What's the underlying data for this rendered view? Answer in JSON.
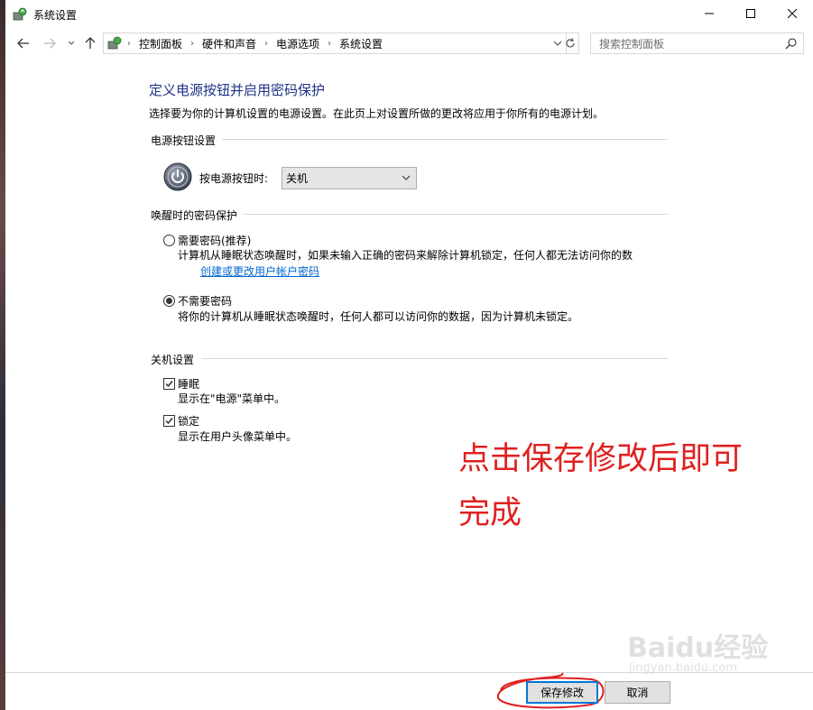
{
  "window": {
    "title": "系统设置",
    "controls": {
      "minimize": "—",
      "maximize": "☐",
      "close": "✕"
    }
  },
  "nav": {
    "back": "←",
    "forward": "→",
    "recent": "⌄",
    "up": "↑",
    "breadcrumbs": [
      "控制面板",
      "硬件和声音",
      "电源选项",
      "系统设置"
    ],
    "separator": "›",
    "dropdown": "⌄",
    "refresh": "↻",
    "search_placeholder": "搜索控制面板"
  },
  "page": {
    "title": "定义电源按钮并启用密码保护",
    "description": "选择要为你的计算机设置的电源设置。在此页上对设置所做的更改将应用于你所有的电源计划。"
  },
  "power_button_section": {
    "heading": "电源按钮设置",
    "label": "按电源按钮时:",
    "selected": "关机"
  },
  "password_section": {
    "heading": "唤醒时的密码保护",
    "option1": {
      "label": "需要密码(推荐)",
      "desc": "计算机从睡眠状态唤醒时，如果未输入正确的密码来解除计算机锁定，任何人都无法访问你的数",
      "link": "创建或更改用户帐户密码",
      "checked": false
    },
    "option2": {
      "label": "不需要密码",
      "desc": "将你的计算机从睡眠状态唤醒时，任何人都可以访问你的数据，因为计算机未锁定。",
      "checked": true
    }
  },
  "shutdown_section": {
    "heading": "关机设置",
    "sleep": {
      "label": "睡眠",
      "desc": "显示在\"电源\"菜单中。",
      "checked": true
    },
    "lock": {
      "label": "锁定",
      "desc": "显示在用户头像菜单中。",
      "checked": true
    }
  },
  "annotation": {
    "line1": "点击保存修改后即可",
    "line2": "完成",
    "color": "#e02020"
  },
  "watermark": {
    "brand": "Baidu经验",
    "url": "jingyan.baidu.com"
  },
  "footer": {
    "save": "保存修改",
    "cancel": "取消"
  }
}
